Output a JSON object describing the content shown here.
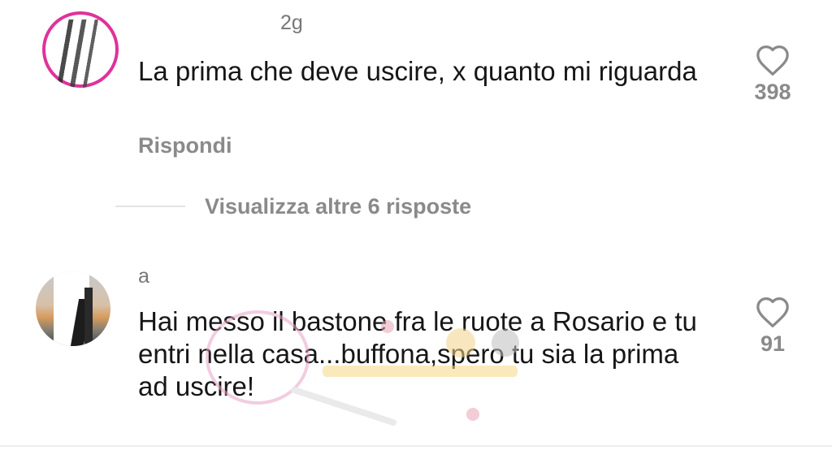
{
  "comments": [
    {
      "username": "",
      "age": "2g",
      "text": "La prima che deve uscire, x quanto mi riguarda",
      "reply_label": "Rispondi",
      "like_count": "398"
    },
    {
      "username": "a",
      "age": "",
      "text": "Hai messo il bastone fra le ruote a Rosario e tu entri nella casa...buffona,spero tu sia la prima ad uscire!",
      "like_count": "91"
    }
  ],
  "view_more_label": "Visualizza altre 6 risposte",
  "icons": {
    "like": "heart-outline-icon"
  },
  "colors": {
    "avatar_ring": "#e0329a",
    "secondary_text": "#8a8a8a"
  }
}
